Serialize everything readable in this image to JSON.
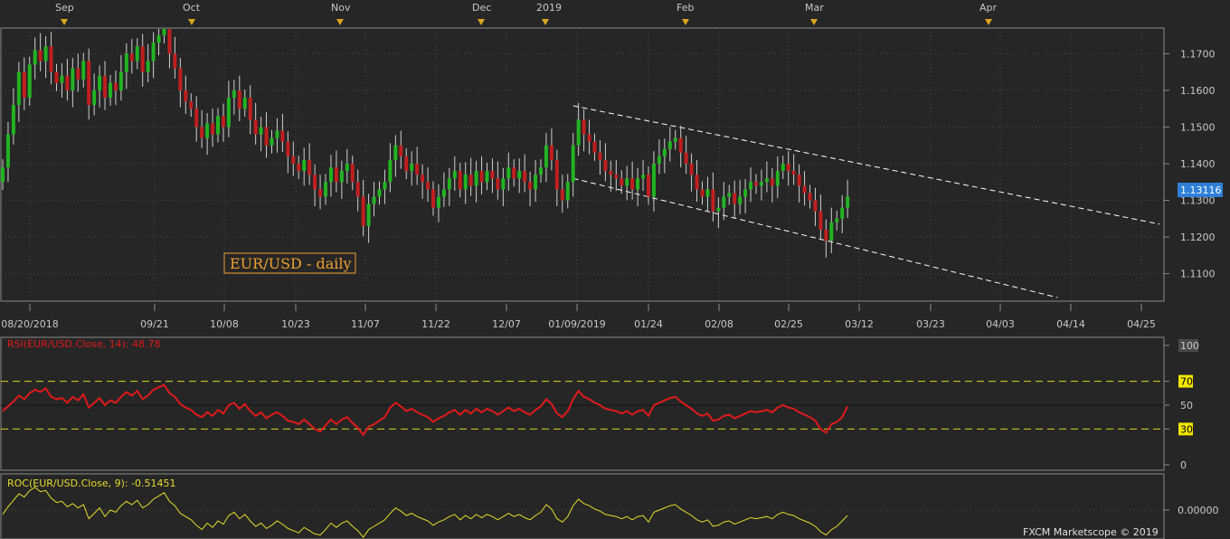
{
  "chart_data": [
    {
      "type": "candlestick",
      "title": "EUR/USD - daily",
      "y_scale": "price",
      "ylim": [
        1.1025,
        1.177
      ],
      "y_ticks": [
        "1.1700",
        "1.1600",
        "1.1500",
        "1.1400",
        "1.1300",
        "1.1200",
        "1.1100"
      ],
      "last_price_label": "1.13116",
      "month_markers": [
        "Sep",
        "Oct",
        "Nov",
        "Dec",
        "2019",
        "Feb",
        "Mar",
        "Apr"
      ],
      "date_ticks": [
        "08/20/2018",
        "09/21",
        "10/08",
        "10/23",
        "11/07",
        "11/22",
        "12/07",
        "01/09/2019",
        "01/24",
        "02/08",
        "02/25",
        "03/12",
        "03/23",
        "04/03",
        "04/14",
        "04/25"
      ],
      "closes": [
        1.139,
        1.148,
        1.156,
        1.165,
        1.158,
        1.167,
        1.171,
        1.168,
        1.172,
        1.165,
        1.162,
        1.164,
        1.16,
        1.166,
        1.163,
        1.168,
        1.156,
        1.16,
        1.164,
        1.158,
        1.162,
        1.16,
        1.165,
        1.17,
        1.168,
        1.172,
        1.165,
        1.168,
        1.173,
        1.175,
        1.178,
        1.17,
        1.166,
        1.16,
        1.157,
        1.155,
        1.15,
        1.147,
        1.151,
        1.148,
        1.153,
        1.15,
        1.158,
        1.16,
        1.155,
        1.158,
        1.152,
        1.148,
        1.15,
        1.145,
        1.147,
        1.149,
        1.146,
        1.142,
        1.14,
        1.138,
        1.141,
        1.137,
        1.133,
        1.131,
        1.135,
        1.139,
        1.135,
        1.138,
        1.14,
        1.135,
        1.131,
        1.123,
        1.129,
        1.131,
        1.133,
        1.135,
        1.141,
        1.145,
        1.142,
        1.138,
        1.14,
        1.137,
        1.135,
        1.133,
        1.128,
        1.131,
        1.133,
        1.136,
        1.138,
        1.133,
        1.137,
        1.134,
        1.138,
        1.135,
        1.138,
        1.136,
        1.133,
        1.136,
        1.139,
        1.136,
        1.138,
        1.135,
        1.133,
        1.137,
        1.139,
        1.145,
        1.141,
        1.133,
        1.13,
        1.135,
        1.145,
        1.152,
        1.148,
        1.146,
        1.143,
        1.141,
        1.138,
        1.137,
        1.136,
        1.134,
        1.136,
        1.133,
        1.136,
        1.137,
        1.131,
        1.14,
        1.142,
        1.144,
        1.146,
        1.147,
        1.143,
        1.14,
        1.137,
        1.133,
        1.131,
        1.133,
        1.127,
        1.128,
        1.131,
        1.132,
        1.129,
        1.131,
        1.133,
        1.135,
        1.134,
        1.135,
        1.136,
        1.134,
        1.138,
        1.14,
        1.138,
        1.137,
        1.134,
        1.132,
        1.13,
        1.127,
        1.122,
        1.119,
        1.124,
        1.125,
        1.128,
        1.131
      ],
      "trendlines": [
        {
          "from": [
            106,
            1.1558
          ],
          "to": [
            215,
            1.1235
          ]
        },
        {
          "from": [
            106,
            1.136
          ],
          "to": [
            196,
            1.1035
          ]
        }
      ]
    },
    {
      "type": "line",
      "label": "RSI(EUR/USD.Close, 14): 48.78",
      "ylim": [
        0,
        100
      ],
      "y_ticks": [
        "100",
        "70",
        "50",
        "30",
        "0"
      ],
      "levels": [
        70,
        50,
        30
      ],
      "values": [
        45,
        49,
        53,
        58,
        55,
        60,
        63,
        61,
        64,
        57,
        55,
        56,
        52,
        57,
        54,
        59,
        48,
        52,
        56,
        50,
        54,
        52,
        57,
        61,
        58,
        62,
        55,
        58,
        63,
        65,
        67,
        60,
        57,
        51,
        48,
        46,
        42,
        40,
        44,
        41,
        46,
        43,
        50,
        52,
        47,
        51,
        45,
        41,
        44,
        39,
        42,
        44,
        41,
        37,
        36,
        34,
        38,
        34,
        30,
        28,
        33,
        38,
        34,
        38,
        40,
        35,
        31,
        25,
        32,
        34,
        37,
        40,
        48,
        52,
        49,
        45,
        47,
        44,
        42,
        40,
        36,
        39,
        41,
        44,
        46,
        42,
        46,
        43,
        47,
        44,
        47,
        45,
        42,
        45,
        48,
        45,
        47,
        44,
        42,
        46,
        49,
        55,
        51,
        43,
        40,
        45,
        55,
        62,
        57,
        55,
        52,
        50,
        47,
        46,
        45,
        43,
        45,
        42,
        45,
        46,
        41,
        50,
        52,
        54,
        56,
        57,
        53,
        50,
        47,
        43,
        41,
        43,
        37,
        38,
        41,
        42,
        39,
        41,
        43,
        45,
        44,
        45,
        46,
        44,
        48,
        50,
        48,
        47,
        44,
        42,
        40,
        37,
        30,
        27,
        34,
        36,
        40,
        49
      ]
    },
    {
      "type": "line",
      "label": "ROC(EUR/USD.Close, 9): -0.51451",
      "y_ticks": [
        "0.00000"
      ],
      "values": [
        -0.4,
        0.3,
        0.9,
        1.5,
        1.2,
        1.8,
        2.1,
        1.7,
        1.8,
        1.1,
        0.7,
        0.8,
        0.3,
        0.6,
        0.2,
        0.5,
        -0.8,
        -0.3,
        0.2,
        -0.6,
        0.0,
        -0.2,
        0.4,
        0.8,
        0.5,
        0.9,
        0.2,
        0.5,
        1.0,
        1.3,
        1.6,
        0.8,
        0.4,
        -0.3,
        -0.6,
        -0.9,
        -1.4,
        -1.8,
        -1.2,
        -1.6,
        -1.0,
        -1.3,
        -0.5,
        -0.2,
        -0.8,
        -0.4,
        -1.0,
        -1.5,
        -1.2,
        -1.7,
        -1.4,
        -1.0,
        -1.3,
        -1.7,
        -1.9,
        -2.1,
        -1.6,
        -1.9,
        -2.2,
        -2.3,
        -1.8,
        -1.2,
        -1.6,
        -1.2,
        -1.0,
        -1.5,
        -1.9,
        -2.5,
        -1.8,
        -1.5,
        -1.2,
        -0.9,
        -0.3,
        0.2,
        -0.1,
        -0.5,
        -0.3,
        -0.6,
        -0.8,
        -1.0,
        -1.4,
        -1.1,
        -0.9,
        -0.6,
        -0.4,
        -0.9,
        -0.5,
        -0.8,
        -0.4,
        -0.7,
        -0.4,
        -0.6,
        -0.9,
        -0.6,
        -0.3,
        -0.6,
        -0.4,
        -0.7,
        -0.9,
        -0.5,
        -0.2,
        0.5,
        0.1,
        -0.8,
        -1.1,
        -0.6,
        0.4,
        1.0,
        0.6,
        0.4,
        0.1,
        -0.1,
        -0.4,
        -0.5,
        -0.6,
        -0.8,
        -0.6,
        -0.9,
        -0.6,
        -0.5,
        -1.1,
        -0.2,
        0.0,
        0.2,
        0.4,
        0.5,
        0.1,
        -0.2,
        -0.5,
        -0.9,
        -1.1,
        -0.9,
        -1.5,
        -1.4,
        -1.1,
        -1.0,
        -1.3,
        -1.1,
        -0.9,
        -0.7,
        -0.8,
        -0.7,
        -0.6,
        -0.8,
        -0.4,
        -0.2,
        -0.4,
        -0.5,
        -0.8,
        -1.0,
        -1.2,
        -1.5,
        -2.0,
        -2.3,
        -1.8,
        -1.5,
        -1.0,
        -0.5
      ]
    }
  ],
  "footer": "FXCM Marketscope © 2019",
  "colors": {
    "background": "#262626",
    "panel_border": "#8a8a8a",
    "up_candle": "#22b322",
    "down_candle": "#c01e1e",
    "rsi_line": "#e01a1a",
    "roc_line": "#e6dc2a",
    "level_dashed": "#d8d820",
    "title_color": "#f0a030",
    "price_tag": "#2f7fd9"
  }
}
